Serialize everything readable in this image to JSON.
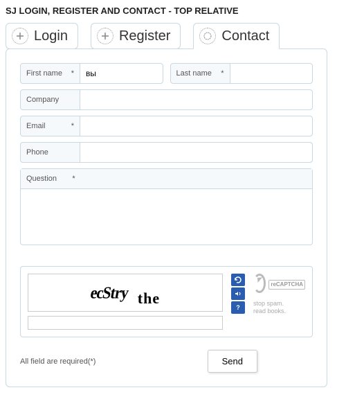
{
  "module_title": "SJ LOGIN, REGISTER AND CONTACT - TOP RELATIVE",
  "tabs": {
    "login": "Login",
    "register": "Register",
    "contact": "Contact"
  },
  "form": {
    "first_name": {
      "label": "First name",
      "required": "*",
      "value": "вы"
    },
    "last_name": {
      "label": "Last name",
      "required": "*",
      "value": ""
    },
    "company": {
      "label": "Company",
      "required": "",
      "value": ""
    },
    "email": {
      "label": "Email",
      "required": "*",
      "value": ""
    },
    "phone": {
      "label": "Phone",
      "required": "",
      "value": ""
    },
    "question": {
      "label": "Question",
      "required": "*",
      "value": ""
    }
  },
  "captcha": {
    "word1": "ecStry",
    "word2": "the",
    "brand": "reCAPTCHA",
    "tag1": "stop spam.",
    "tag2": "read books.",
    "input_value": ""
  },
  "footnote": "All field are required(*)",
  "send_label": "Send"
}
